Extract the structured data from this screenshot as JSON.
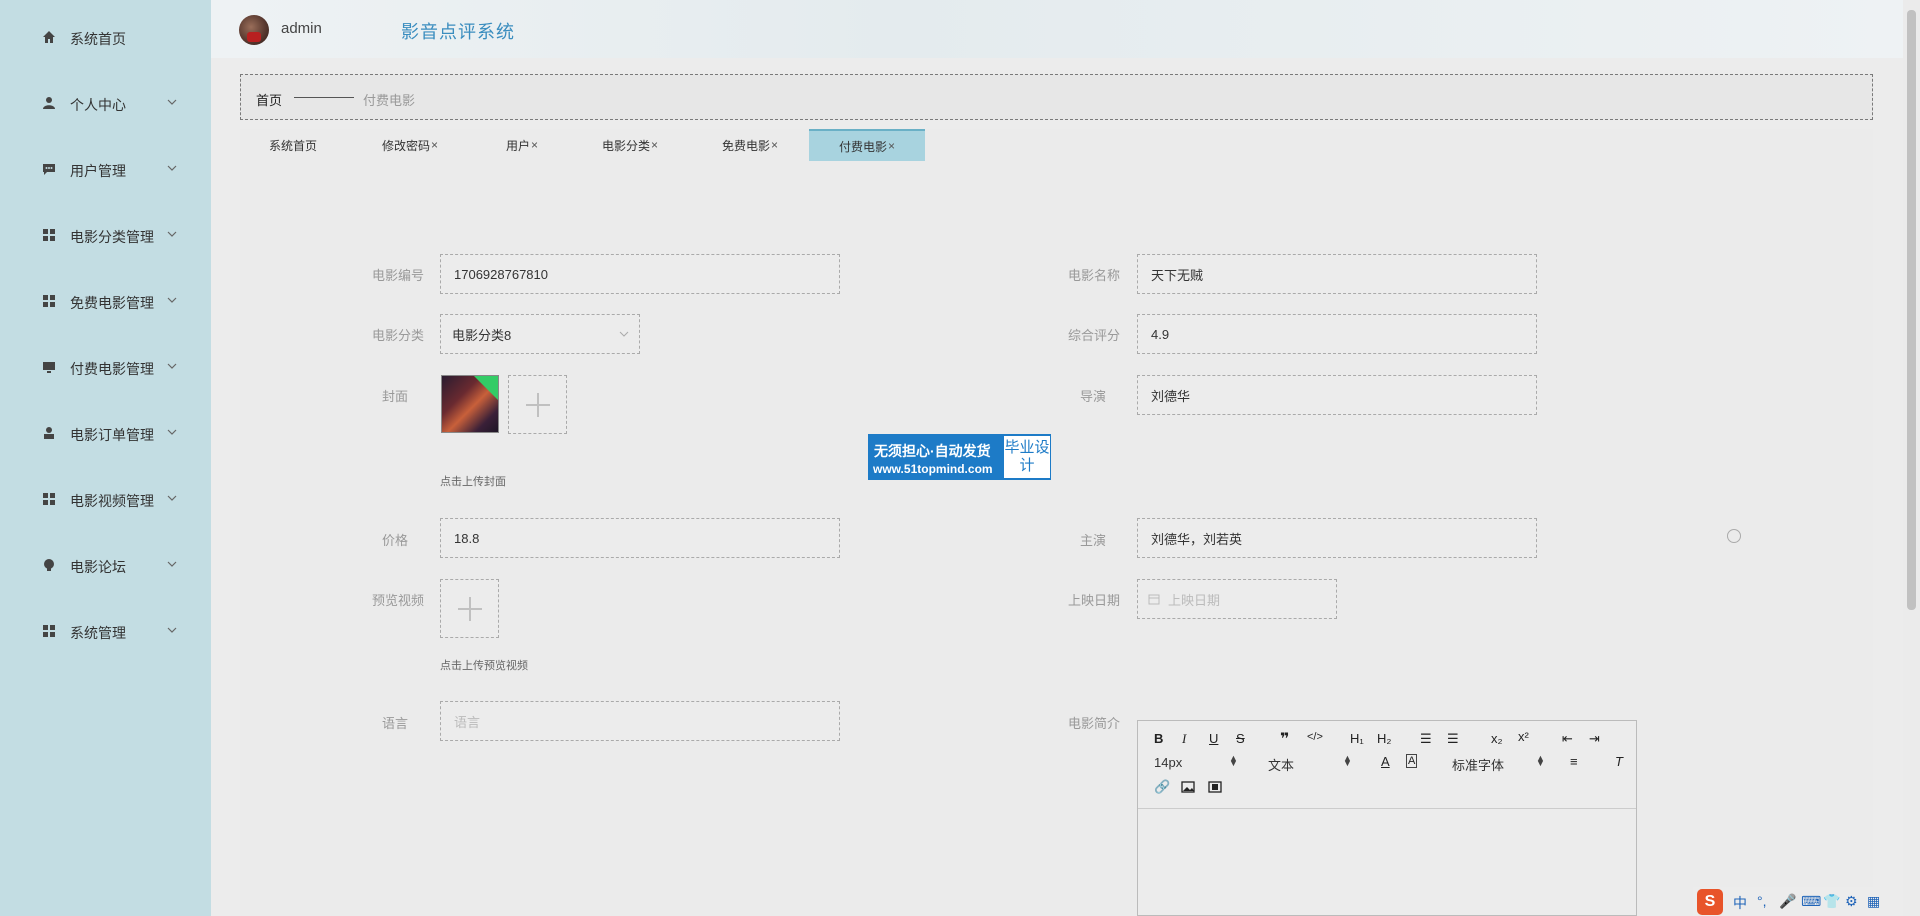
{
  "app": {
    "title": "影音点评系统",
    "admin_name": "admin"
  },
  "sidebar": {
    "items": [
      {
        "label": "系统首页",
        "icon": "home-icon",
        "expandable": false
      },
      {
        "label": "个人中心",
        "icon": "user-icon",
        "expandable": true
      },
      {
        "label": "用户管理",
        "icon": "chat-icon",
        "expandable": true
      },
      {
        "label": "电影分类管理",
        "icon": "grid-icon",
        "expandable": true
      },
      {
        "label": "免费电影管理",
        "icon": "grid-icon",
        "expandable": true
      },
      {
        "label": "付费电影管理",
        "icon": "monitor-icon",
        "expandable": true
      },
      {
        "label": "电影订单管理",
        "icon": "person-icon",
        "expandable": true
      },
      {
        "label": "电影视频管理",
        "icon": "grid-icon",
        "expandable": true
      },
      {
        "label": "电影论坛",
        "icon": "bulb-icon",
        "expandable": true
      },
      {
        "label": "系统管理",
        "icon": "grid-icon",
        "expandable": true
      }
    ]
  },
  "breadcrumb": {
    "home": "首页",
    "current": "付费电影"
  },
  "tabs": [
    {
      "label": "系统首页",
      "closable": false,
      "active": false
    },
    {
      "label": "修改密码",
      "closable": true,
      "active": false
    },
    {
      "label": "用户",
      "closable": true,
      "active": false
    },
    {
      "label": "电影分类",
      "closable": true,
      "active": false
    },
    {
      "label": "免费电影",
      "closable": true,
      "active": false
    },
    {
      "label": "付费电影",
      "closable": true,
      "active": true
    }
  ],
  "tab_close_glyph": "×",
  "form": {
    "movie_no": {
      "label": "电影编号",
      "value": "1706928767810"
    },
    "movie_name": {
      "label": "电影名称",
      "value": "天下无贼"
    },
    "category": {
      "label": "电影分类",
      "value": "电影分类8"
    },
    "rating": {
      "label": "综合评分",
      "value": "4.9"
    },
    "cover": {
      "label": "封面",
      "hint": "点击上传封面"
    },
    "director": {
      "label": "导演",
      "value": "刘德华"
    },
    "price": {
      "label": "价格",
      "value": "18.8"
    },
    "actors": {
      "label": "主演",
      "value": "刘德华，刘若英"
    },
    "preview": {
      "label": "预览视频",
      "hint": "点击上传预览视频"
    },
    "release_date": {
      "label": "上映日期",
      "placeholder": "上映日期"
    },
    "language": {
      "label": "语言",
      "placeholder": "语言"
    },
    "intro": {
      "label": "电影简介"
    }
  },
  "editor": {
    "font_size": "14px",
    "header_select": "文本",
    "font_family": "标准字体"
  },
  "watermark": {
    "line1": "无须担心·自动发货",
    "line2": "www.51topmind.com",
    "box": "毕业设计"
  },
  "ime": {
    "lang": "中",
    "punct": "°,"
  },
  "colors": {
    "sidebar_bg": "#c3dde3",
    "title": "#3a8dbf",
    "active_tab": "#a8d3df"
  }
}
